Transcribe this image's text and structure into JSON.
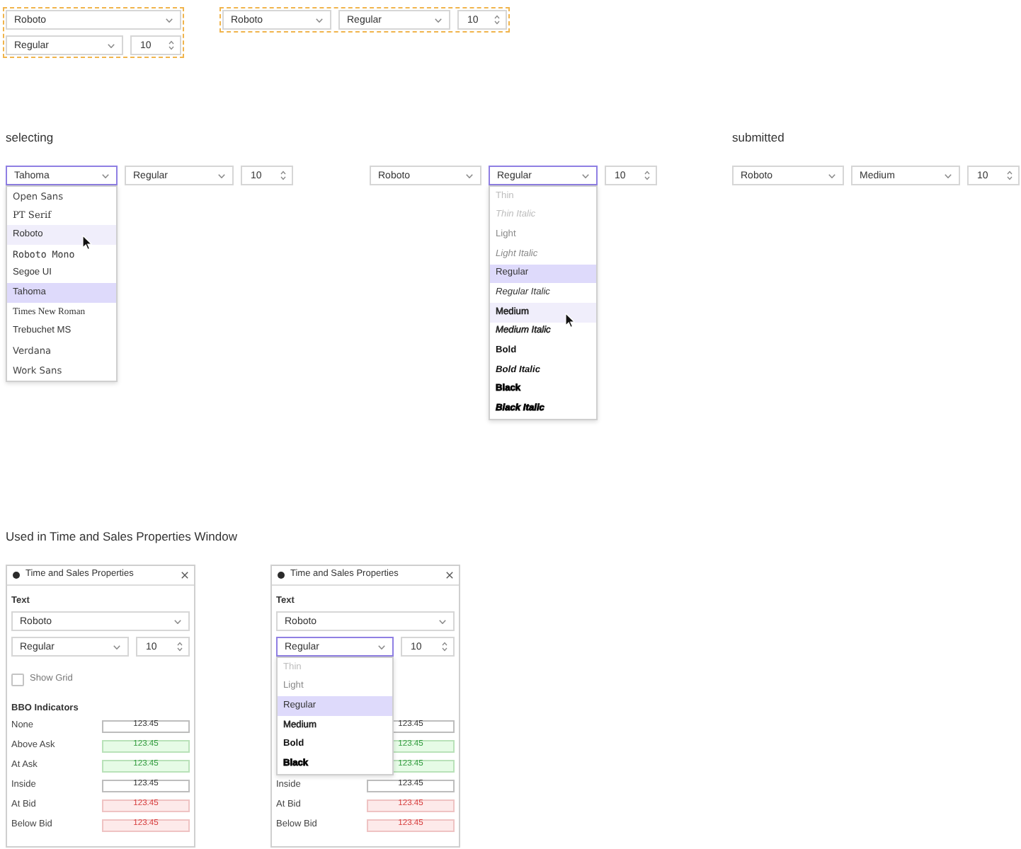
{
  "examples": [
    {
      "kind": "stacked",
      "font": {
        "value": "Roboto",
        "focused": false
      },
      "style": {
        "value": "Regular",
        "focused": false
      },
      "size": {
        "value": "10"
      }
    },
    {
      "kind": "inline",
      "font": {
        "value": "Roboto",
        "focused": false
      },
      "style": {
        "value": "Regular",
        "focused": false
      },
      "size": {
        "value": "10"
      }
    }
  ],
  "sections": [
    {
      "heading": "selecting",
      "groups": [
        {
          "font": {
            "value": "Tahoma",
            "focused": true,
            "menu": [
              {
                "label": "Open Sans",
                "kind": "wide",
                "selected": false,
                "hovered": false
              },
              {
                "label": "PT Serif",
                "kind": "serif",
                "selected": false,
                "hovered": false
              },
              {
                "label": "Roboto",
                "kind": "sans",
                "selected": false,
                "hovered": true
              },
              {
                "label": "Roboto Mono",
                "kind": "mono",
                "selected": false,
                "hovered": false
              },
              {
                "label": "Segoe UI",
                "kind": "sans",
                "selected": false,
                "hovered": false
              },
              {
                "label": "Tahoma",
                "kind": "sans",
                "selected": true,
                "hovered": false
              },
              {
                "label": "Times New Roman",
                "kind": "roman",
                "selected": false,
                "hovered": false
              },
              {
                "label": "Trebuchet MS",
                "kind": "sans",
                "selected": false,
                "hovered": false
              },
              {
                "label": "Verdana",
                "kind": "wide",
                "selected": false,
                "hovered": false
              },
              {
                "label": "Work Sans",
                "kind": "wide",
                "selected": false,
                "hovered": false
              }
            ]
          },
          "style": {
            "value": "Regular",
            "focused": false
          },
          "size": {
            "value": "10"
          }
        },
        {
          "font": {
            "value": "Roboto",
            "focused": false
          },
          "style": {
            "value": "Regular",
            "focused": true,
            "menu": [
              {
                "label": "Thin",
                "kind": "thin",
                "italic": false,
                "selected": false,
                "hovered": false
              },
              {
                "label": "Thin Italic",
                "kind": "thin",
                "italic": true,
                "selected": false,
                "hovered": false
              },
              {
                "label": "Light",
                "kind": "light",
                "italic": false,
                "selected": false,
                "hovered": false
              },
              {
                "label": "Light Italic",
                "kind": "light",
                "italic": true,
                "selected": false,
                "hovered": false
              },
              {
                "label": "Regular",
                "kind": "regular",
                "italic": false,
                "selected": true,
                "hovered": false
              },
              {
                "label": "Regular Italic",
                "kind": "regular",
                "italic": true,
                "selected": false,
                "hovered": false
              },
              {
                "label": "Medium",
                "kind": "medium",
                "italic": false,
                "selected": false,
                "hovered": true
              },
              {
                "label": "Medium Italic",
                "kind": "medium",
                "italic": true,
                "selected": false,
                "hovered": false
              },
              {
                "label": "Bold",
                "kind": "bold",
                "italic": false,
                "selected": false,
                "hovered": false
              },
              {
                "label": "Bold Italic",
                "kind": "bold",
                "italic": true,
                "selected": false,
                "hovered": false
              },
              {
                "label": "Black",
                "kind": "black",
                "italic": false,
                "selected": false,
                "hovered": false
              },
              {
                "label": "Black Italic",
                "kind": "black",
                "italic": true,
                "selected": false,
                "hovered": false
              }
            ]
          },
          "size": {
            "value": "10"
          }
        }
      ]
    },
    {
      "heading": "submitted",
      "groups": [
        {
          "font": {
            "value": "Roboto",
            "focused": false
          },
          "style": {
            "value": "Medium",
            "focused": false
          },
          "size": {
            "value": "10"
          }
        }
      ]
    }
  ],
  "usage": {
    "heading": "Used in Time and Sales Properties Window",
    "windows": [
      {
        "title": "Time and Sales Properties",
        "section_label": "Text",
        "font": {
          "value": "Roboto",
          "focused": false
        },
        "style": {
          "value": "Regular",
          "focused": false
        },
        "size": {
          "value": "10"
        },
        "show_grid": {
          "label": "Show Grid",
          "checked": false
        },
        "indicators_title": "BBO Indicators",
        "indicators": [
          {
            "label": "None",
            "value": "123.45",
            "kind": "neutral"
          },
          {
            "label": "Above Ask",
            "value": "123.45",
            "kind": "positive"
          },
          {
            "label": "At Ask",
            "value": "123.45",
            "kind": "positive"
          },
          {
            "label": "Inside",
            "value": "123.45",
            "kind": "neutral"
          },
          {
            "label": "At Bid",
            "value": "123.45",
            "kind": "negative"
          },
          {
            "label": "Below Bid",
            "value": "123.45",
            "kind": "negative"
          }
        ]
      },
      {
        "title": "Time and Sales Properties",
        "section_label": "Text",
        "font": {
          "value": "Roboto",
          "focused": false
        },
        "style": {
          "value": "Regular",
          "focused": true,
          "menu": [
            {
              "label": "Thin",
              "kind": "thin",
              "italic": false,
              "selected": false,
              "hovered": false
            },
            {
              "label": "Light",
              "kind": "light",
              "italic": false,
              "selected": false,
              "hovered": false
            },
            {
              "label": "Regular",
              "kind": "regular",
              "italic": false,
              "selected": true,
              "hovered": false
            },
            {
              "label": "Medium",
              "kind": "medium",
              "italic": false,
              "selected": false,
              "hovered": false
            },
            {
              "label": "Bold",
              "kind": "bold",
              "italic": false,
              "selected": false,
              "hovered": false
            },
            {
              "label": "Black",
              "kind": "black",
              "italic": false,
              "selected": false,
              "hovered": false
            }
          ]
        },
        "size": {
          "value": "10"
        },
        "indicators": [
          {
            "value": "123.45",
            "kind": "neutral"
          },
          {
            "value": "123.45",
            "kind": "positive"
          },
          {
            "value": "123.45",
            "kind": "positive"
          },
          {
            "label": "Inside",
            "value": "123.45",
            "kind": "neutral"
          },
          {
            "label": "At Bid",
            "value": "123.45",
            "kind": "negative"
          },
          {
            "label": "Below Bid",
            "value": "123.45",
            "kind": "negative"
          }
        ]
      }
    ]
  }
}
